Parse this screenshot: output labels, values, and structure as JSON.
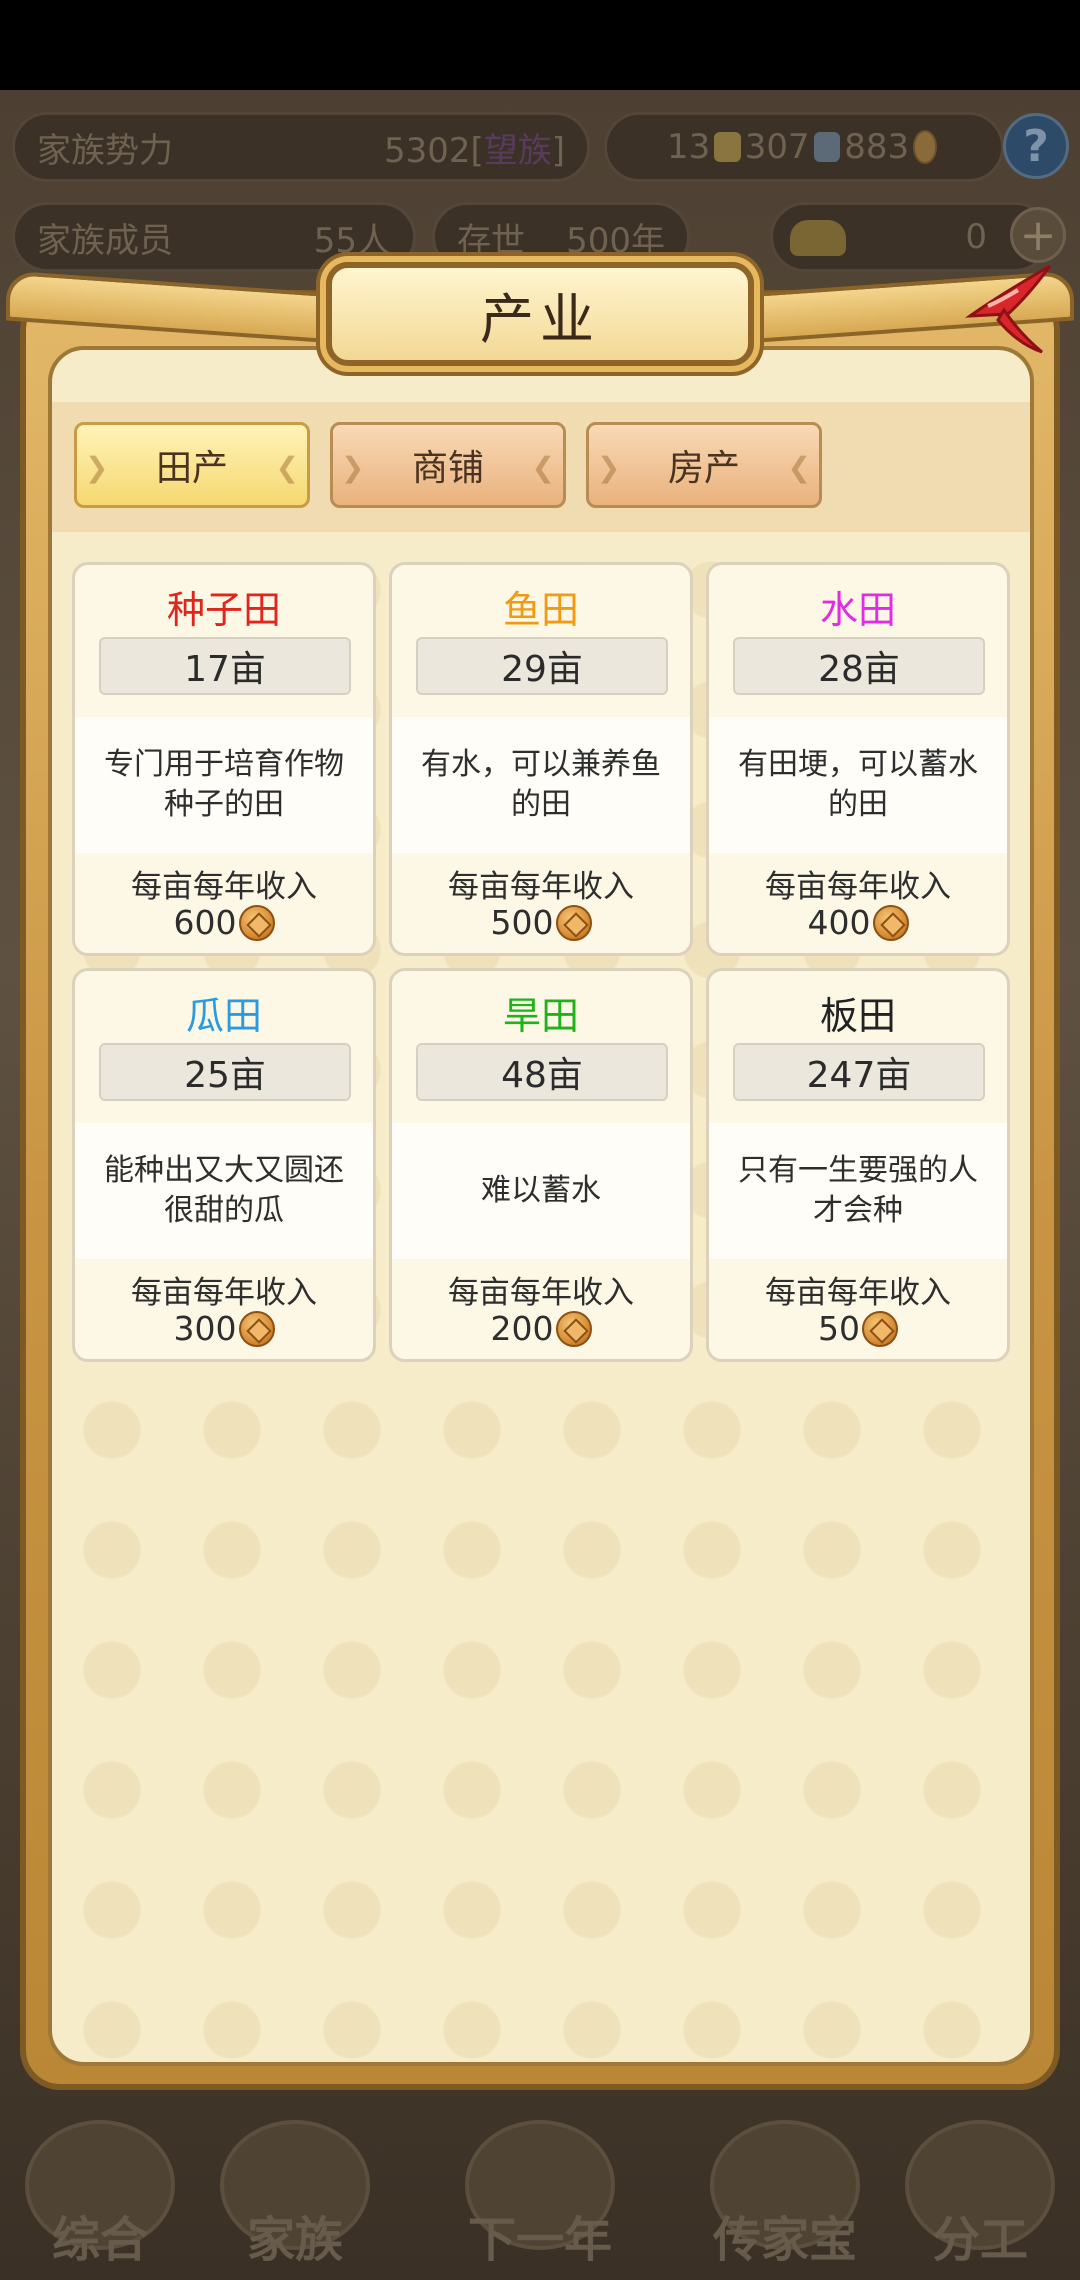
{
  "header": {
    "power_label": "家族势力",
    "power_value": "5302",
    "power_rank_open": "[",
    "power_rank": "望族",
    "power_rank_close": "]",
    "gold_count": "13",
    "silver_count": "307",
    "coin_count": "883",
    "help_label": "?",
    "members_label": "家族成员",
    "members_value": "55人",
    "age_label": "存世",
    "age_value": "500年",
    "ingot_count": "0",
    "plus_label": "+"
  },
  "modal": {
    "title": "产业",
    "tabs": [
      {
        "label": "田产",
        "active": true
      },
      {
        "label": "商铺",
        "active": false
      },
      {
        "label": "房产",
        "active": false
      }
    ],
    "income_label": "每亩每年收入",
    "fields": [
      {
        "name": "种子田",
        "color": "#e0261b",
        "qty": "17亩",
        "desc": "专门用于培育作物种子的田",
        "income": "600"
      },
      {
        "name": "鱼田",
        "color": "#f29a13",
        "qty": "29亩",
        "desc": "有水，可以兼养鱼的田",
        "income": "500"
      },
      {
        "name": "水田",
        "color": "#e12be7",
        "qty": "28亩",
        "desc": "有田埂，可以蓄水的田",
        "income": "400"
      },
      {
        "name": "瓜田",
        "color": "#2b9be0",
        "qty": "25亩",
        "desc": "能种出又大又圆还很甜的瓜",
        "income": "300"
      },
      {
        "name": "旱田",
        "color": "#1fb21a",
        "qty": "48亩",
        "desc": "难以蓄水",
        "income": "200"
      },
      {
        "name": "板田",
        "color": "#222222",
        "qty": "247亩",
        "desc": "只有一生要强的人才会种",
        "income": "50"
      }
    ]
  },
  "bottom_nav": [
    {
      "label": "综合"
    },
    {
      "label": "家族"
    },
    {
      "label": "下一年"
    },
    {
      "label": "传家宝"
    },
    {
      "label": "分工"
    }
  ]
}
